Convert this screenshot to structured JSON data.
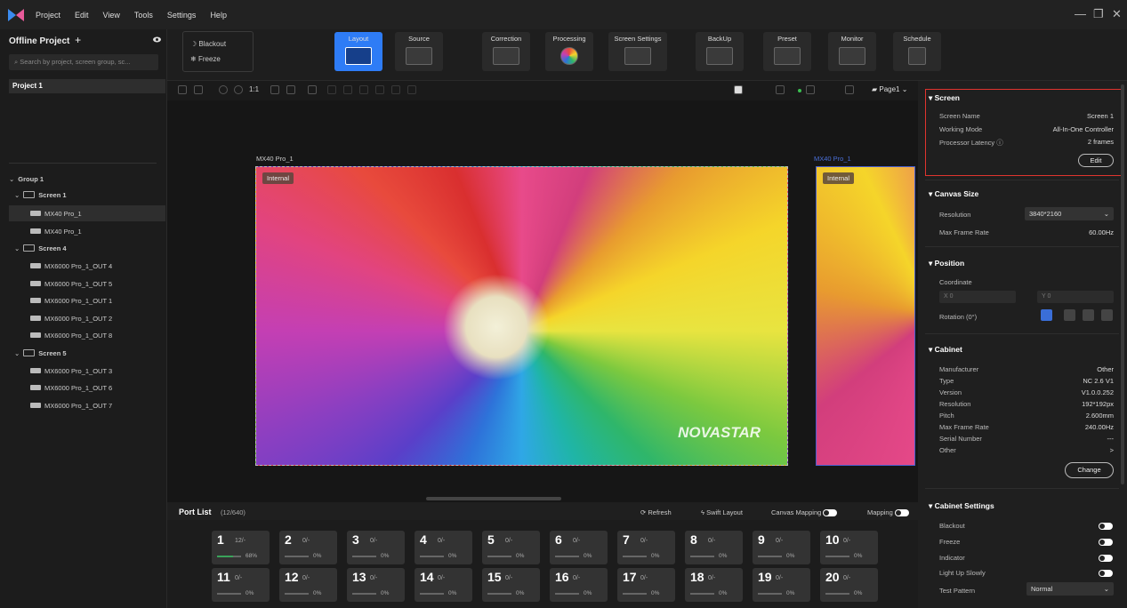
{
  "menubar": {
    "items": [
      "Project",
      "Edit",
      "View",
      "Tools",
      "Settings",
      "Help"
    ],
    "window_controls": [
      "—",
      "❐",
      "✕"
    ]
  },
  "left": {
    "title": "Offline Project",
    "add": "+",
    "search_placeholder": "Search by project, screen group, sc...",
    "project": "Project 1",
    "group": "Group 1",
    "screen1": "Screen 1",
    "s1_items": [
      "MX40 Pro_1",
      "MX40 Pro_1"
    ],
    "screen4": "Screen 4",
    "s4_items": [
      "MX6000 Pro_1_OUT 4",
      "MX6000 Pro_1_OUT 5",
      "MX6000 Pro_1_OUT 1",
      "MX6000 Pro_1_OUT 2",
      "MX6000 Pro_1_OUT 8"
    ],
    "screen5": "Screen 5",
    "s5_items": [
      "MX6000 Pro_1_OUT 3",
      "MX6000 Pro_1_OUT 6",
      "MX6000 Pro_1_OUT 7"
    ]
  },
  "toolbar": {
    "blackout": "Blackout",
    "freeze": "Freeze",
    "buttons": [
      "Layout",
      "Source",
      "Correction",
      "Processing",
      "Screen Settings",
      "BackUp",
      "Preset",
      "Monitor",
      "Schedule"
    ]
  },
  "iconrow": {
    "zoom_label": "1:1",
    "page": "Page1"
  },
  "canvas": {
    "screen_a": "MX40 Pro_1",
    "screen_b": "MX40 Pro_1",
    "internal": "Internal",
    "watermark": "NOVASTAR"
  },
  "portbar": {
    "title": "Port List",
    "count": "(12/640)",
    "refresh": "Refresh",
    "swift": "Swift Layout",
    "canvas_mapping": "Canvas Mapping",
    "mapping": "Mapping"
  },
  "ports": [
    {
      "n": "1",
      "c": "12/-",
      "p": "68%",
      "progress": 0.68
    },
    {
      "n": "2",
      "c": "0/-",
      "p": "0%",
      "progress": 0
    },
    {
      "n": "3",
      "c": "0/-",
      "p": "0%",
      "progress": 0
    },
    {
      "n": "4",
      "c": "0/-",
      "p": "0%",
      "progress": 0
    },
    {
      "n": "5",
      "c": "0/-",
      "p": "0%",
      "progress": 0
    },
    {
      "n": "6",
      "c": "0/-",
      "p": "0%",
      "progress": 0
    },
    {
      "n": "7",
      "c": "0/-",
      "p": "0%",
      "progress": 0
    },
    {
      "n": "8",
      "c": "0/-",
      "p": "0%",
      "progress": 0
    },
    {
      "n": "9",
      "c": "0/-",
      "p": "0%",
      "progress": 0
    },
    {
      "n": "10",
      "c": "0/-",
      "p": "0%",
      "progress": 0
    },
    {
      "n": "11",
      "c": "0/-",
      "p": "0%",
      "progress": 0
    },
    {
      "n": "12",
      "c": "0/-",
      "p": "0%",
      "progress": 0
    },
    {
      "n": "13",
      "c": "0/-",
      "p": "0%",
      "progress": 0
    },
    {
      "n": "14",
      "c": "0/-",
      "p": "0%",
      "progress": 0
    },
    {
      "n": "15",
      "c": "0/-",
      "p": "0%",
      "progress": 0
    },
    {
      "n": "16",
      "c": "0/-",
      "p": "0%",
      "progress": 0
    },
    {
      "n": "17",
      "c": "0/-",
      "p": "0%",
      "progress": 0
    },
    {
      "n": "18",
      "c": "0/-",
      "p": "0%",
      "progress": 0
    },
    {
      "n": "19",
      "c": "0/-",
      "p": "0%",
      "progress": 0
    },
    {
      "n": "20",
      "c": "0/-",
      "p": "0%",
      "progress": 0
    }
  ],
  "right": {
    "screen": {
      "title": "Screen",
      "name_label": "Screen Name",
      "name": "Screen 1",
      "mode_label": "Working Mode",
      "mode": "All-In-One Controller",
      "lat_label": "Processor Latency",
      "lat": "2 frames",
      "edit": "Edit"
    },
    "canvas": {
      "title": "Canvas Size",
      "res_label": "Resolution",
      "res": "3840*2160",
      "fr_label": "Max Frame Rate",
      "fr": "60.00Hz"
    },
    "position": {
      "title": "Position",
      "coord": "Coordinate",
      "x_label": "X",
      "x": "0",
      "y_label": "Y",
      "y": "0",
      "rotation": "Rotation (0°)"
    },
    "cabinet": {
      "title": "Cabinet",
      "rows": [
        [
          "Manufacturer",
          "Other"
        ],
        [
          "Type",
          "NC 2.6 V1"
        ],
        [
          "Version",
          "V1.0.0.252"
        ],
        [
          "Resolution",
          "192*192px"
        ],
        [
          "Pitch",
          "2.600mm"
        ],
        [
          "Max Frame Rate",
          "240.00Hz"
        ],
        [
          "Serial Number",
          "---"
        ],
        [
          "Other",
          ">"
        ]
      ],
      "change": "Change"
    },
    "settings": {
      "title": "Cabinet Settings",
      "blackout": "Blackout",
      "freeze": "Freeze",
      "indicator": "Indicator",
      "light": "Light Up Slowly",
      "test": "Test Pattern",
      "test_value": "Normal"
    }
  },
  "colors": {
    "accent": "#2e7cf6",
    "highlight_box": "#e0342f",
    "panel": "#1f1f1f",
    "progress": "#3aa35a"
  }
}
